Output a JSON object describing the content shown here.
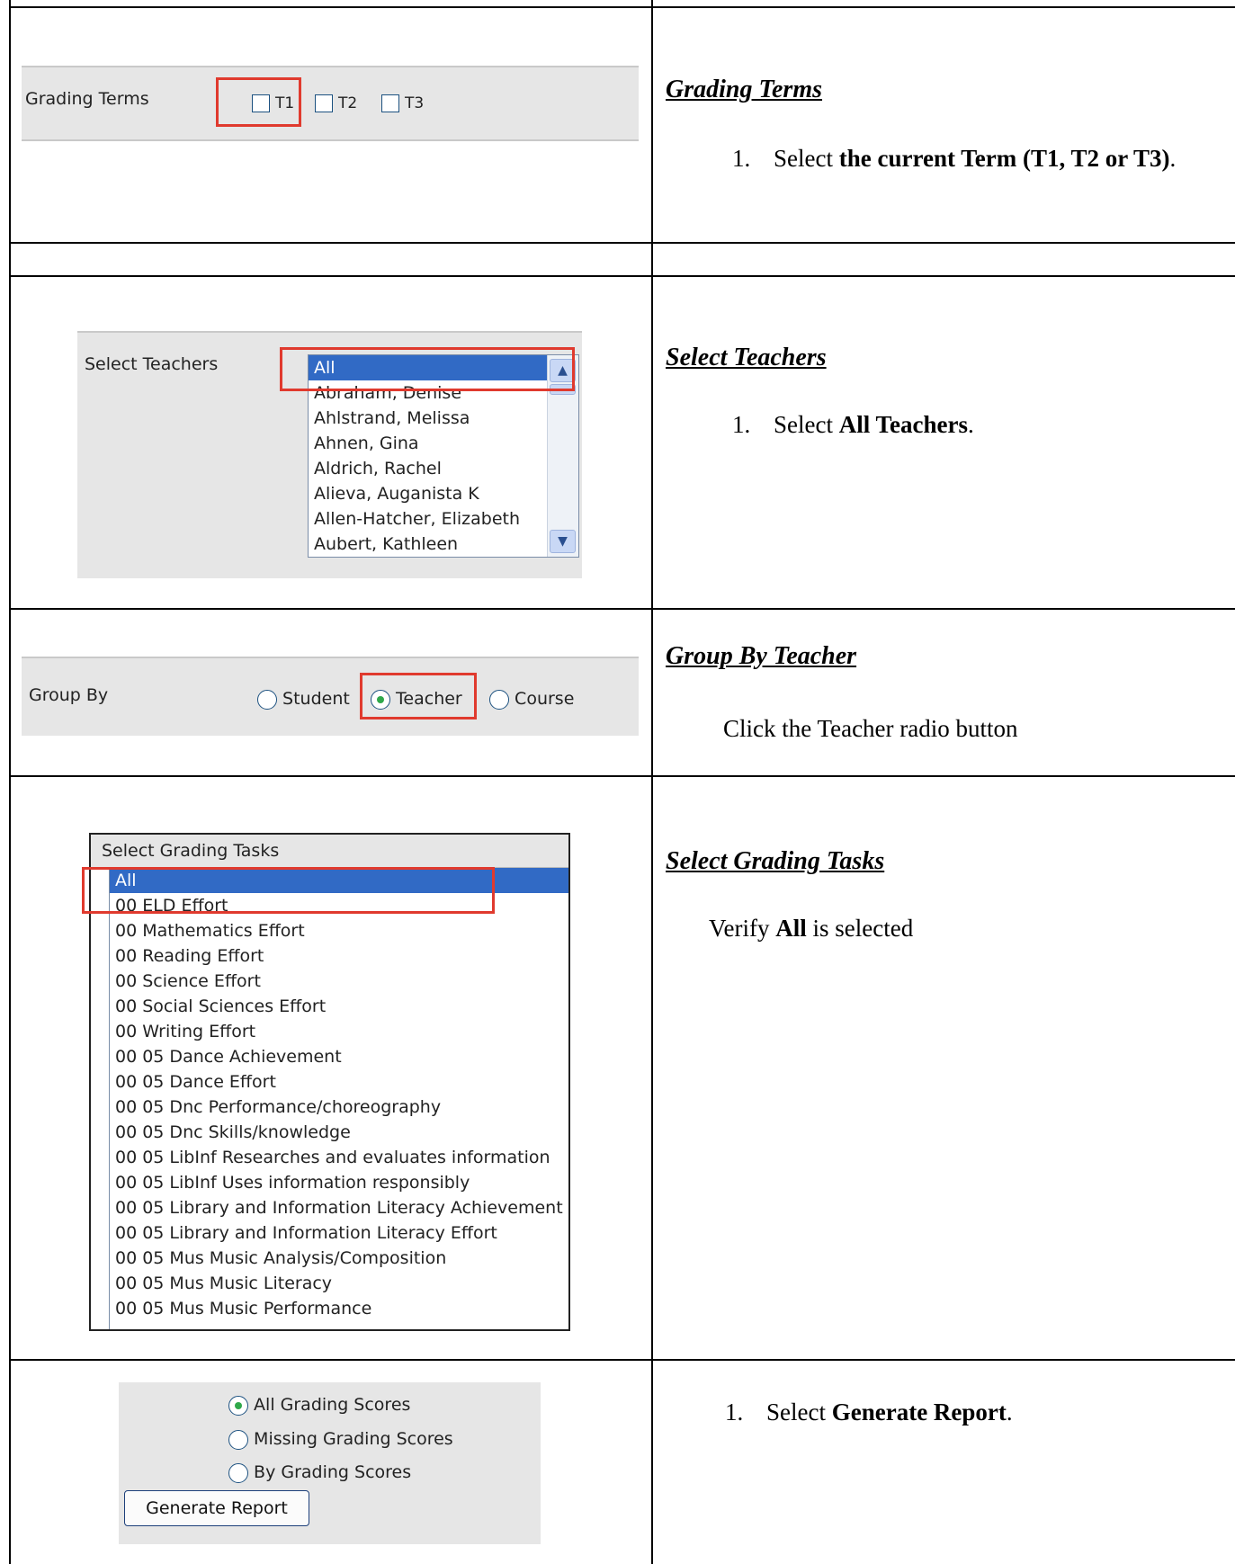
{
  "rows": [
    {
      "ui": {
        "label": "Grading Terms",
        "terms": [
          "T1",
          "T2",
          "T3"
        ]
      },
      "heading": "Grading Terms",
      "step_number": "1.",
      "instruction_prefix": "Select ",
      "instruction_bold": "the current Term (T1, T2 or T3)",
      "instruction_suffix": "."
    },
    {
      "ui": {
        "label": "Select Teachers",
        "items": [
          "All",
          "Abraham, Denise",
          "Ahlstrand, Melissa",
          "Ahnen, Gina",
          "Aldrich, Rachel",
          "Alieva, Auganista K",
          "Allen-Hatcher, Elizabeth",
          "Aubert, Kathleen"
        ],
        "selected": "All"
      },
      "heading": "Select Teachers",
      "step_number": "1.",
      "instruction_prefix": "Select ",
      "instruction_bold": "All Teachers",
      "instruction_suffix": "."
    },
    {
      "ui": {
        "label": "Group By",
        "options": [
          "Student",
          "Teacher",
          "Course"
        ],
        "selected": "Teacher"
      },
      "heading": "Group By Teacher",
      "instruction": "Click the Teacher radio button"
    },
    {
      "ui": {
        "label": "Select Grading Tasks",
        "items": [
          "All",
          "00 ELD Effort",
          "00 Mathematics Effort",
          "00 Reading Effort",
          "00 Science Effort",
          "00 Social Sciences Effort",
          "00 Writing Effort",
          "00 05 Dance Achievement",
          "00 05 Dance Effort",
          "00 05 Dnc Performance/choreography",
          "00 05 Dnc Skills/knowledge",
          "00 05 LibInf Researches and evaluates information",
          "00 05 LibInf Uses information responsibly",
          "00 05 Library and Information Literacy Achievement",
          "00 05 Library and Information Literacy Effort",
          "00 05 Mus Music Analysis/Composition",
          "00 05 Mus Music Literacy",
          "00 05 Mus Music Performance"
        ],
        "selected": "All"
      },
      "heading": "Select Grading Tasks",
      "instruction_prefix": "Verify ",
      "instruction_bold": "All",
      "instruction_suffix": " is selected"
    },
    {
      "ui": {
        "options": [
          "All Grading Scores",
          "Missing Grading Scores",
          "By Grading Scores"
        ],
        "selected": "All Grading Scores",
        "button": "Generate Report"
      },
      "step_number": "1.",
      "instruction_prefix": "Select ",
      "instruction_bold": "Generate Report",
      "instruction_suffix": "."
    }
  ],
  "colors": {
    "highlight": "#e03a2e",
    "selection": "#316ac5",
    "panel": "#e6e6e6",
    "radio_dot": "#2fa84a"
  }
}
